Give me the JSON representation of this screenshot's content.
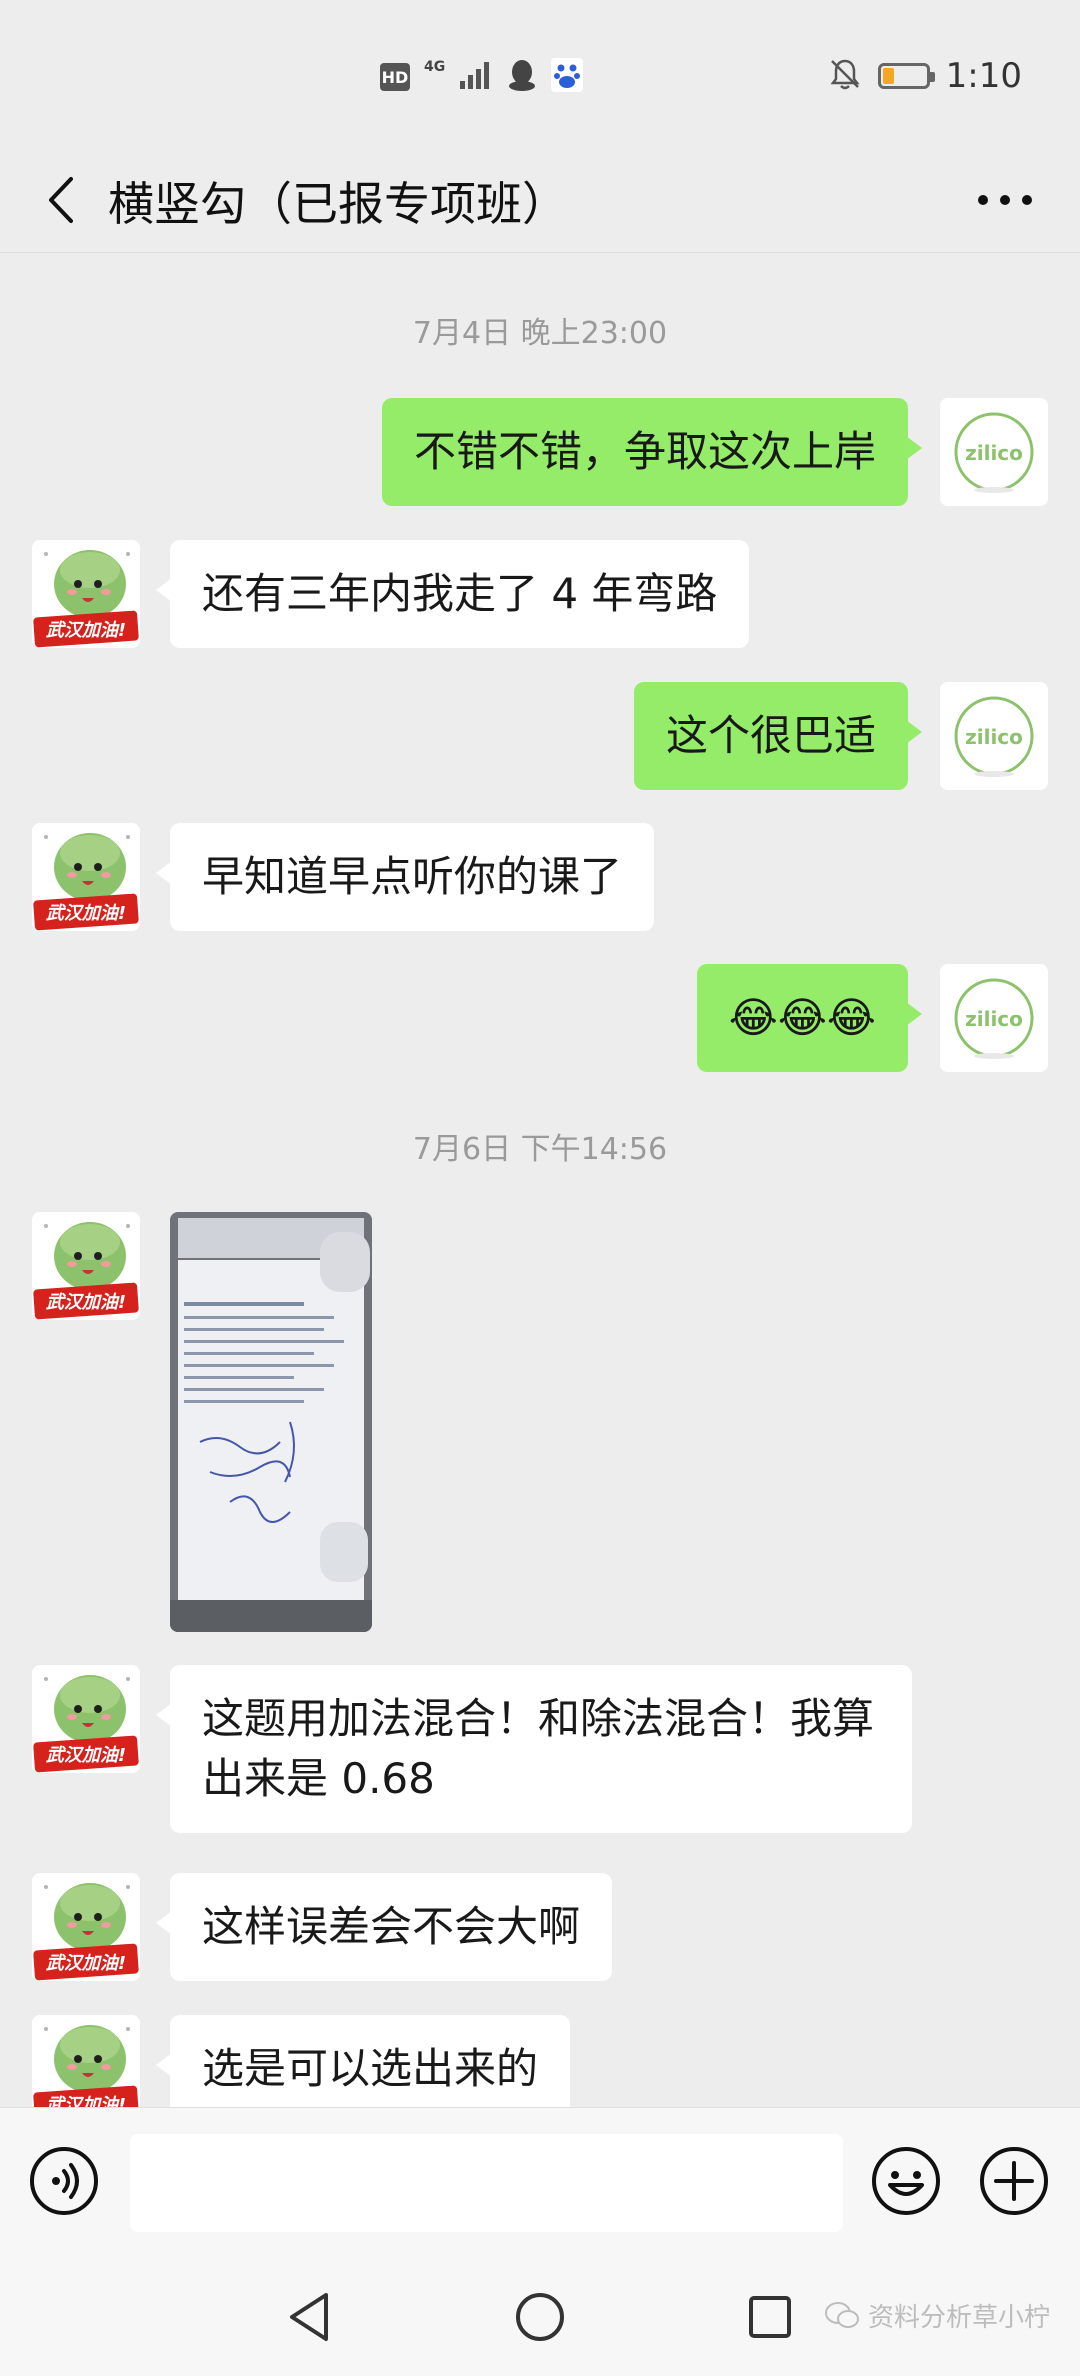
{
  "status_bar": {
    "hd_label": "HD",
    "network_label": "4G",
    "time": "1:10",
    "battery_level": 0.25,
    "icons": [
      "signal-icon",
      "qq-icon",
      "baidu-icon",
      "mute-icon",
      "battery-icon"
    ]
  },
  "header": {
    "title": "横竖勾（已报专项班）",
    "back_icon": "chevron-left-icon",
    "more_icon": "more-dots-icon"
  },
  "messages": {
    "ts1": "7月4日 晚上23:00",
    "m1": "不错不错，争取这次上岸",
    "m2": "还有三年内我走了 4 年弯路",
    "m3": "这个很巴适",
    "m4": "早知道早点听你的课了",
    "m5": "😂😂😂",
    "ts2": "7月6日 下午14:56",
    "m7": "这题用加法混合！和除法混合！我算出来是 0.68",
    "m8": "这样误差会不会大啊",
    "m9": "选是可以选出来的"
  },
  "avatars": {
    "other_label": "武汉加油!",
    "self_label": "zilico"
  },
  "input_bar": {
    "placeholder": "",
    "voice_icon": "voice-icon",
    "emoji_icon": "emoji-icon",
    "plus_icon": "plus-icon"
  },
  "nav_bar": {
    "watermark": "资料分析草小柠"
  },
  "colors": {
    "background": "#ededed",
    "self_bubble": "#95ec69",
    "other_bubble": "#ffffff",
    "badge_red": "#d6221d",
    "avatar_green": "#8cc26b"
  }
}
